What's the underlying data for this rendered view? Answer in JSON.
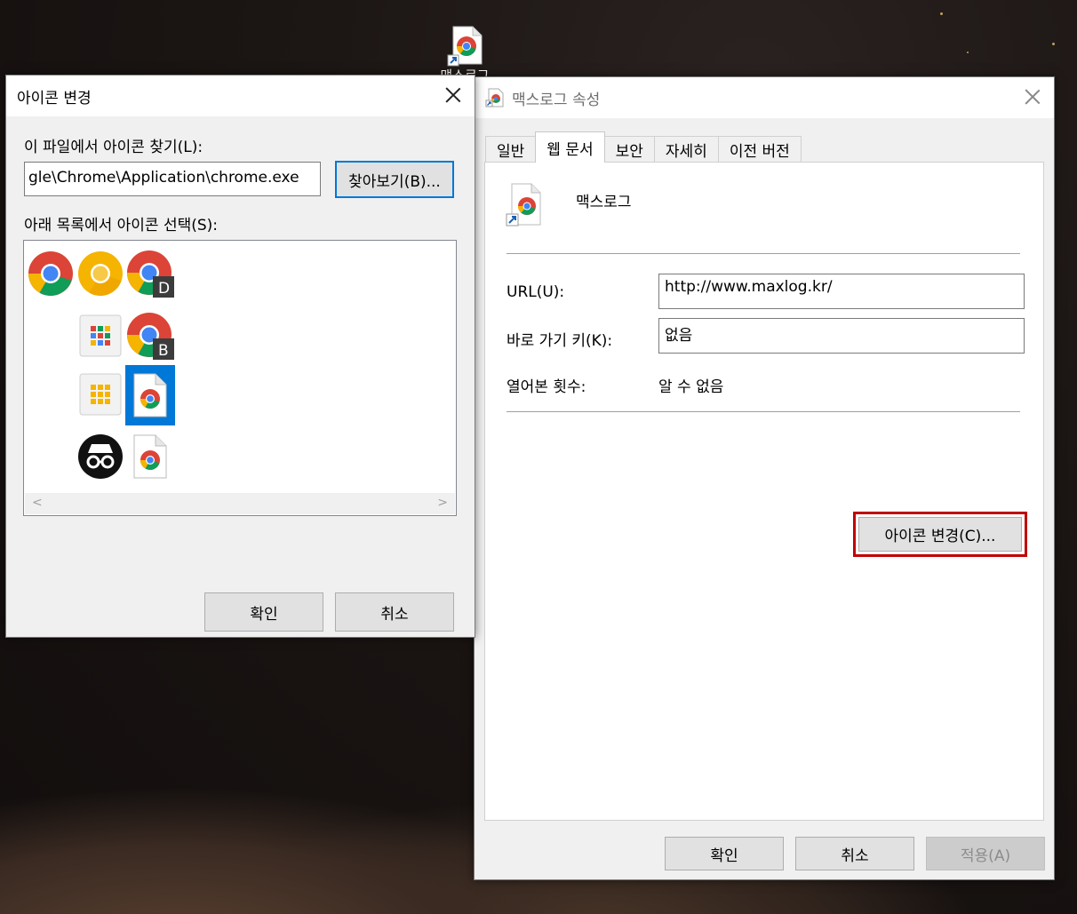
{
  "desktop": {
    "shortcut_label": "맥스로그"
  },
  "properties": {
    "title": "맥스로그 속성",
    "tabs": [
      "일반",
      "웹 문서",
      "보안",
      "자세히",
      "이전 버전"
    ],
    "active_tab": "웹 문서",
    "shortcut_name": "맥스로그",
    "url_label": "URL(U):",
    "url_value": "http://www.maxlog.kr/",
    "hotkey_label": "바로 가기 키(K):",
    "hotkey_value": "없음",
    "visits_label": "열어본 횟수:",
    "visits_value": "알 수 없음",
    "change_icon_button": "아이콘 변경(C)...",
    "ok_button": "확인",
    "cancel_button": "취소",
    "apply_button": "적용(A)",
    "highlight_color": "#c00000"
  },
  "change_icon": {
    "title": "아이콘 변경",
    "find_label": "이 파일에서 아이콘 찾기(L):",
    "path_value": "gle\\Chrome\\Application\\chrome.exe",
    "browse_button": "찾아보기(B)...",
    "list_label": "아래 목록에서 아이콘 선택(S):",
    "icons": [
      "chrome-icon",
      "chrome-canary-icon",
      "chrome-dev-icon",
      "apps-grid-icon",
      "chrome-beta-icon",
      "apps-grid-yellow-icon",
      "chrome-doc-icon",
      "incognito-icon",
      "chrome-doc-icon"
    ],
    "selected_icon": "chrome-doc-icon",
    "ok_button": "확인",
    "cancel_button": "취소",
    "selection_color": "#0078d7"
  }
}
